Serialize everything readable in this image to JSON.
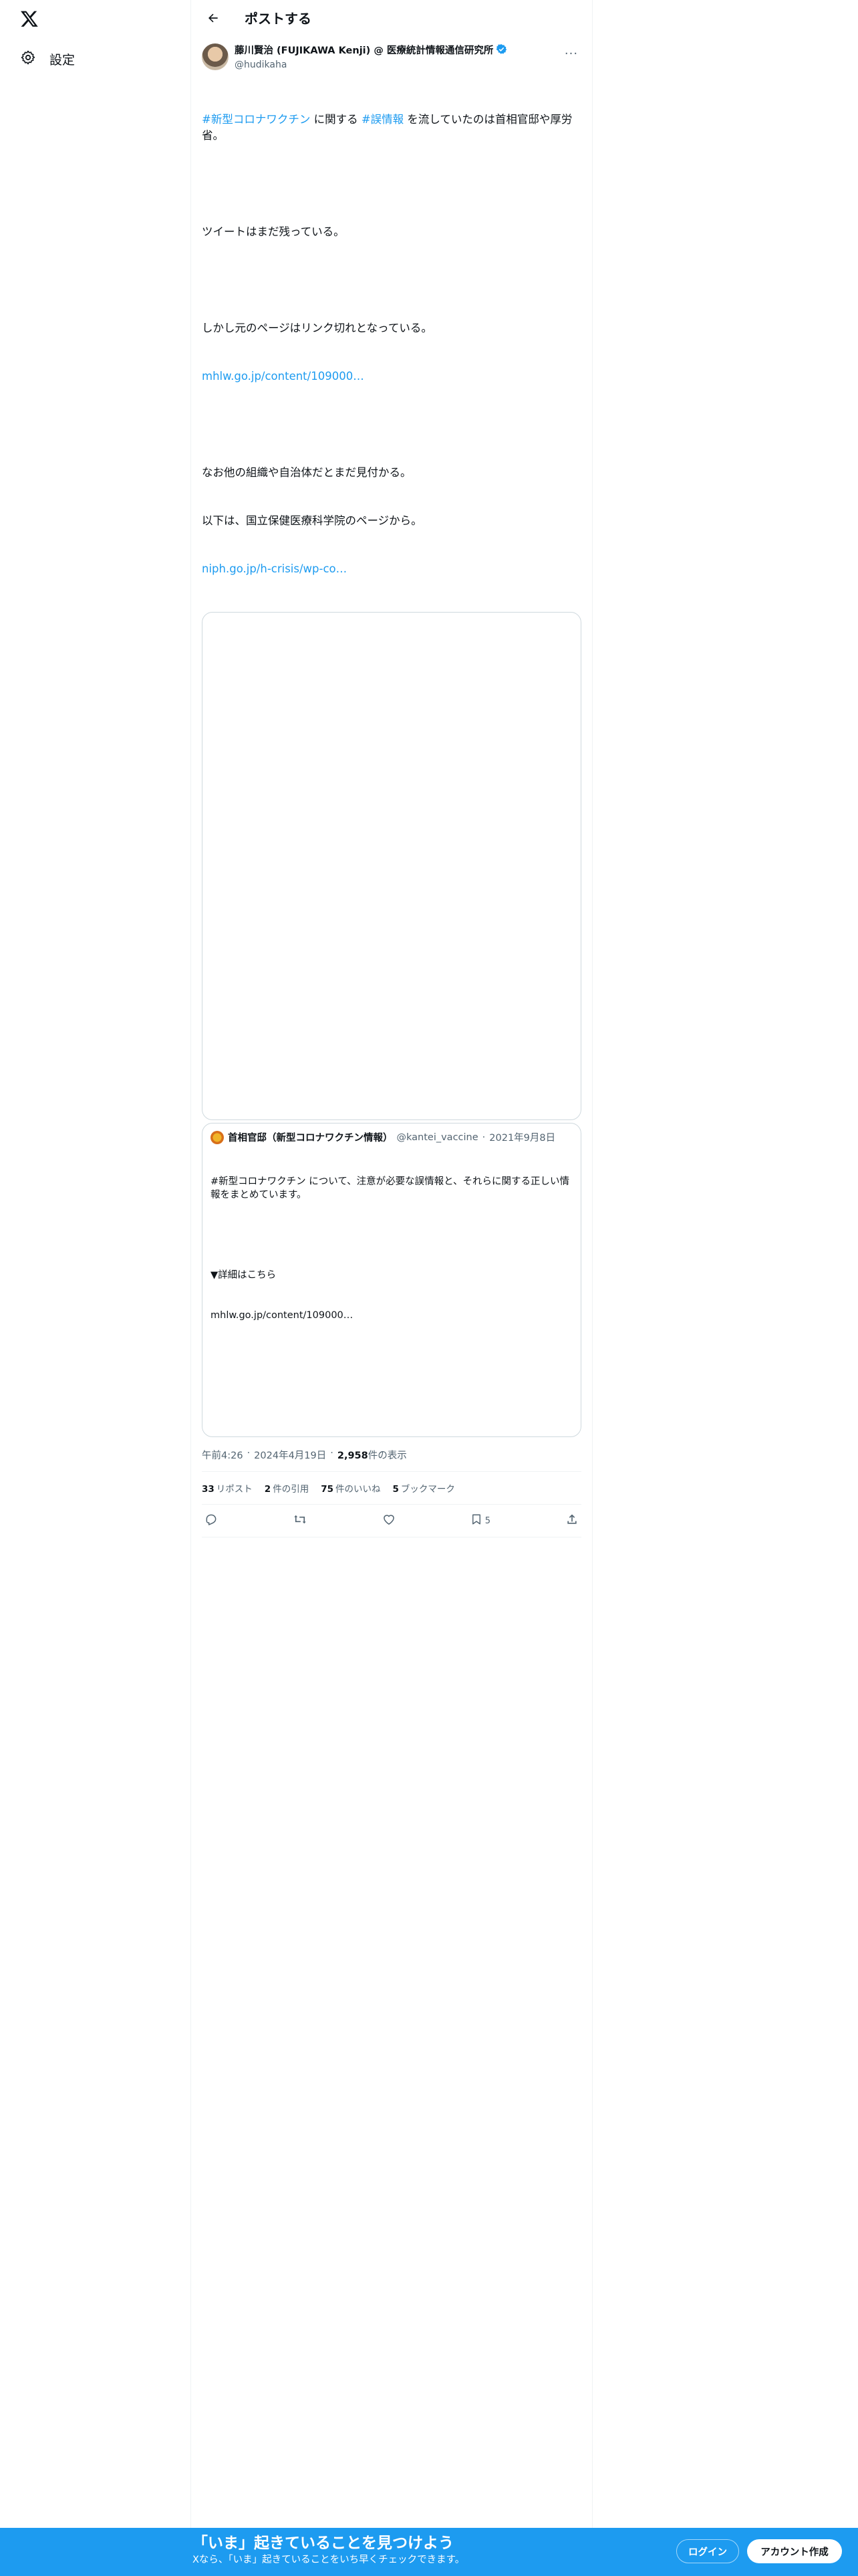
{
  "nav": {
    "settings_label": "設定"
  },
  "header": {
    "title": "ポストする"
  },
  "post": {
    "author_name": "藤川賢治 (FUJIKAWA Kenji) @ 医療統計情報通信研究所",
    "author_handle": "@hudikaha",
    "verified": true,
    "body": {
      "hashtag1": "#新型コロナワクチン",
      "text1": " に関する ",
      "hashtag2": "#誤情報",
      "text2": " を流していたのは首相官邸や厚労省。",
      "line2": "ツイートはまだ残っている。",
      "line3": "しかし元のページはリンク切れとなっている。",
      "link1": "mhlw.go.jp/content/109000…",
      "line4": "なお他の組織や自治体だとまだ見付かる。",
      "line5": "以下は、国立保健医療科学院のページから。",
      "link2": "niph.go.jp/h-crisis/wp-co…"
    },
    "quote": {
      "name": "首相官邸（新型コロナワクチン情報）",
      "handle": "@kantei_vaccine",
      "date": "2021年9月8日",
      "line1": "#新型コロナワクチン について、注意が必要な誤情報と、それらに関する正しい情報をまとめています。",
      "line2": "▼詳細はこちら",
      "line3": "mhlw.go.jp/content/109000…"
    },
    "time": "午前4:26",
    "date": "2024年4月19日",
    "views_count": "2,958",
    "views_label": "件の表示",
    "stats": {
      "reposts_count": "33",
      "reposts_label": "リポスト",
      "quotes_count": "2",
      "quotes_label": "件の引用",
      "likes_count": "75",
      "likes_label": "件のいいね",
      "bookmarks_count": "5",
      "bookmarks_label": "ブックマーク"
    },
    "actions": {
      "bookmark_count": "5"
    }
  },
  "bottom_bar": {
    "title": "「いま」起きていることを見つけよう",
    "subtitle": "Xなら、「いま」起きていることをいち早くチェックできます。",
    "login_label": "ログイン",
    "signup_label": "アカウント作成"
  },
  "colors": {
    "accent": "#1d9bf0",
    "text": "#0f1419",
    "muted": "#536471",
    "border": "#cfd9de"
  }
}
